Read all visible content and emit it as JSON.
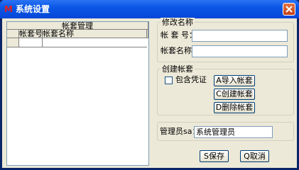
{
  "window": {
    "title": "系统设置",
    "icon": "app-icon"
  },
  "left": {
    "grid_title": "帐套管理",
    "columns": [
      "帐套号",
      "帐套名称"
    ]
  },
  "modify": {
    "legend": "修改名称",
    "account_no_label": "帐 套 号：",
    "account_no_value": "",
    "account_name_label": "帐套名称：",
    "account_name_value": ""
  },
  "create": {
    "legend": "创建帐套",
    "include_voucher_label": "包含凭证",
    "import_label": "A导入帐套",
    "create_label": "C创建帐套",
    "delete_label": "D删除帐套"
  },
  "admin": {
    "label": "管理员sa：",
    "value": "系统管理员"
  },
  "footer": {
    "save_label": "S保存",
    "cancel_label": "Q取消"
  },
  "colors": {
    "titlebar": "#0a57e5",
    "face": "#ece9d8"
  }
}
